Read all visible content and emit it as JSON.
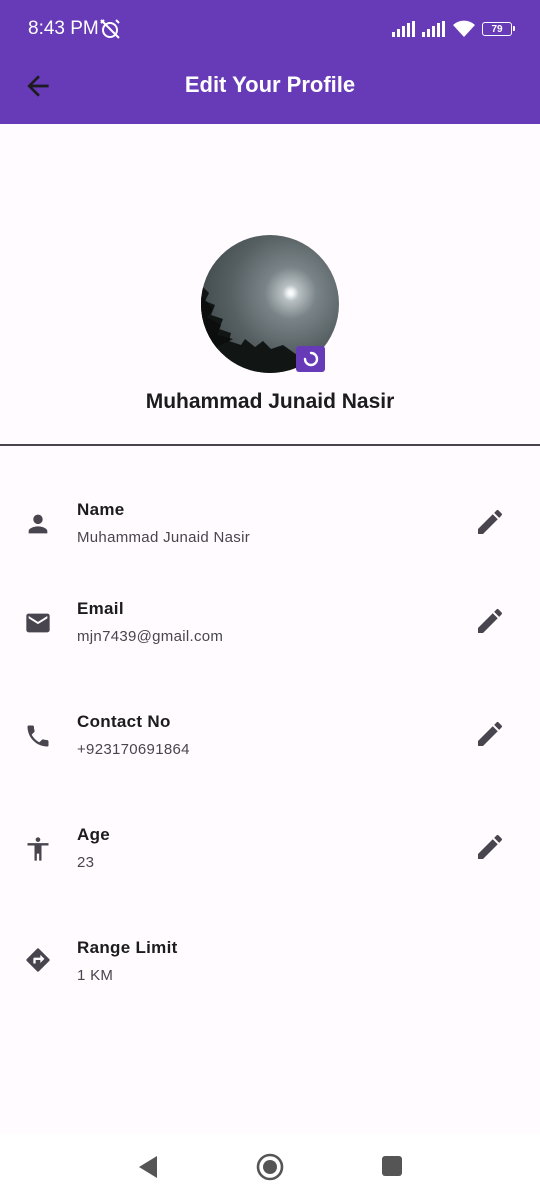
{
  "status_bar": {
    "time": "8:43 PM",
    "battery": "79"
  },
  "app_bar": {
    "title": "Edit Your Profile",
    "back_icon": "arrow-back-icon"
  },
  "profile": {
    "name": "Muhammad Junaid Nasir",
    "camera_icon": "camera-icon"
  },
  "fields": [
    {
      "label": "Name",
      "value": "Muhammad Junaid Nasir",
      "icon": "person-icon",
      "editable": true
    },
    {
      "label": "Email",
      "value": "mjn7439@gmail.com",
      "icon": "mail-icon",
      "editable": true
    },
    {
      "label": "Contact No",
      "value": "+923170691864",
      "icon": "phone-icon",
      "editable": true
    },
    {
      "label": "Age",
      "value": "23",
      "icon": "accessibility-icon",
      "editable": true
    },
    {
      "label": "Range Limit",
      "value": "1 KM",
      "icon": "directions-icon",
      "editable": false
    }
  ],
  "colors": {
    "primary": "#673ab7",
    "background": "#fffbfe",
    "icon": "#49454f",
    "text": "#1c1b1f"
  }
}
